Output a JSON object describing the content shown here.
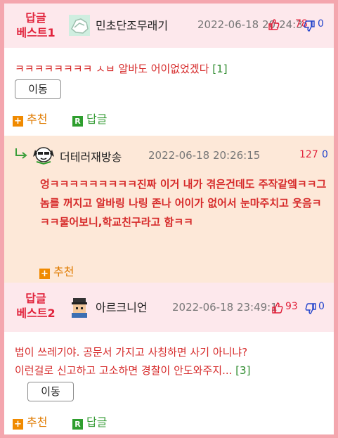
{
  "comments": [
    {
      "badge_line1": "답글",
      "badge_line2": "베스트1",
      "nickname": "민초단조무래기",
      "date": "2022-06-18 20:24:3",
      "up": "78",
      "down": "0",
      "body": "ㅋㅋㅋㅋㅋㅋㅋㅋ ㅅㅂ 알바도 어이없었겠다",
      "reply_count": "[1]",
      "move_label": "이동",
      "recommend_label": "추천",
      "reply_label": "답글"
    },
    {
      "badge_line1": "답글",
      "badge_line2": "베스트2",
      "nickname": "아르크니언",
      "date": "2022-06-18 23:49:1",
      "up": "93",
      "down": "0",
      "body_line1": "법이 쓰레기야. 공문서 가지고 사칭하면 사기 아니냐?",
      "body_line2": "이런걸로 신고하고 고소하면 경찰이 안도와주지...",
      "reply_count": "[3]",
      "move_label": "이동",
      "recommend_label": "추천",
      "reply_label": "답글"
    }
  ],
  "reply": {
    "nickname": "더테러재방송",
    "date": "2022-06-18 20:26:15",
    "up": "127",
    "down": "0",
    "body": "엉ㅋㅋㅋㅋㅋㅋㅋㅋㅋ진짜 이거 내가 겪은건데도 주작같엨ㅋㅋ그놈를 꺼지고 알바링 나링 존나 어이가 없어서 눈마주치고 웃음ㅋㅋㅋ물어보니,학교친구라고 함ㅋㅋ",
    "recommend_label": "추천"
  },
  "colors": {
    "accent": "#e1233c",
    "outer_bg": "#f4a6ae",
    "header_bg": "#fde8ec",
    "reply_bg": "#fde8d8"
  }
}
